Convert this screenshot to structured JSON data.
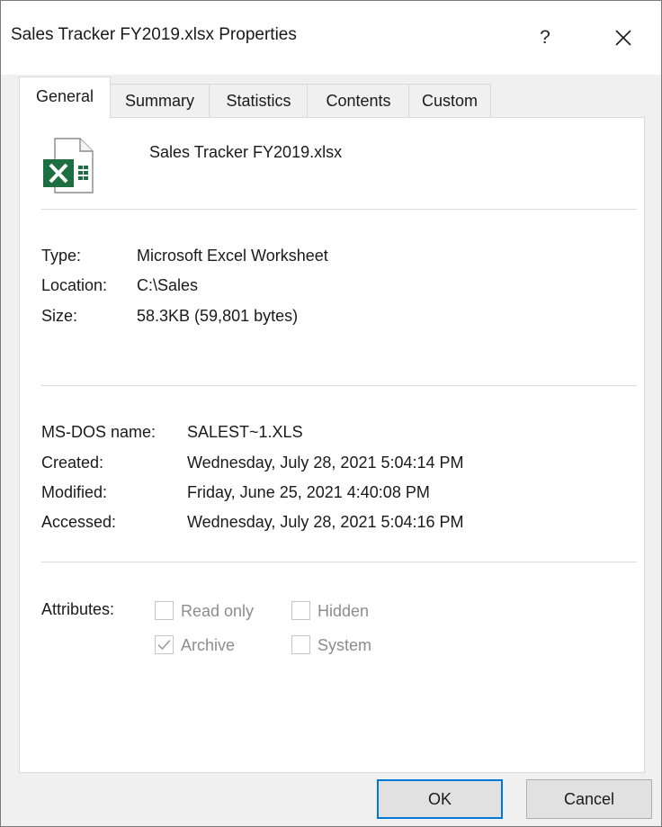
{
  "window": {
    "title": "Sales Tracker FY2019.xlsx Properties",
    "help_label": "?",
    "close_label": "Close"
  },
  "tabs": [
    {
      "label": "General",
      "active": true
    },
    {
      "label": "Summary",
      "active": false
    },
    {
      "label": "Statistics",
      "active": false
    },
    {
      "label": "Contents",
      "active": false
    },
    {
      "label": "Custom",
      "active": false
    }
  ],
  "general": {
    "file_icon": "excel-file-icon",
    "file_name": "Sales Tracker FY2019.xlsx",
    "type_label": "Type:",
    "type_value": "Microsoft Excel Worksheet",
    "location_label": "Location:",
    "location_value": "C:\\Sales",
    "size_label": "Size:",
    "size_value": "58.3KB (59,801 bytes)",
    "msdos_label": "MS-DOS name:",
    "msdos_value": "SALEST~1.XLS",
    "created_label": "Created:",
    "created_value": "Wednesday, July 28, 2021 5:04:14 PM",
    "modified_label": "Modified:",
    "modified_value": "Friday, June 25, 2021 4:40:08 PM",
    "accessed_label": "Accessed:",
    "accessed_value": "Wednesday, July 28, 2021 5:04:16 PM",
    "attributes_label": "Attributes:",
    "attributes": {
      "read_only": {
        "label": "Read only",
        "checked": false
      },
      "hidden": {
        "label": "Hidden",
        "checked": false
      },
      "archive": {
        "label": "Archive",
        "checked": true
      },
      "system": {
        "label": "System",
        "checked": false
      }
    }
  },
  "buttons": {
    "ok": "OK",
    "cancel": "Cancel"
  },
  "colors": {
    "excel_green": "#1d6f42",
    "accent_blue": "#0078d7",
    "disabled_text": "#8d8d8d"
  }
}
